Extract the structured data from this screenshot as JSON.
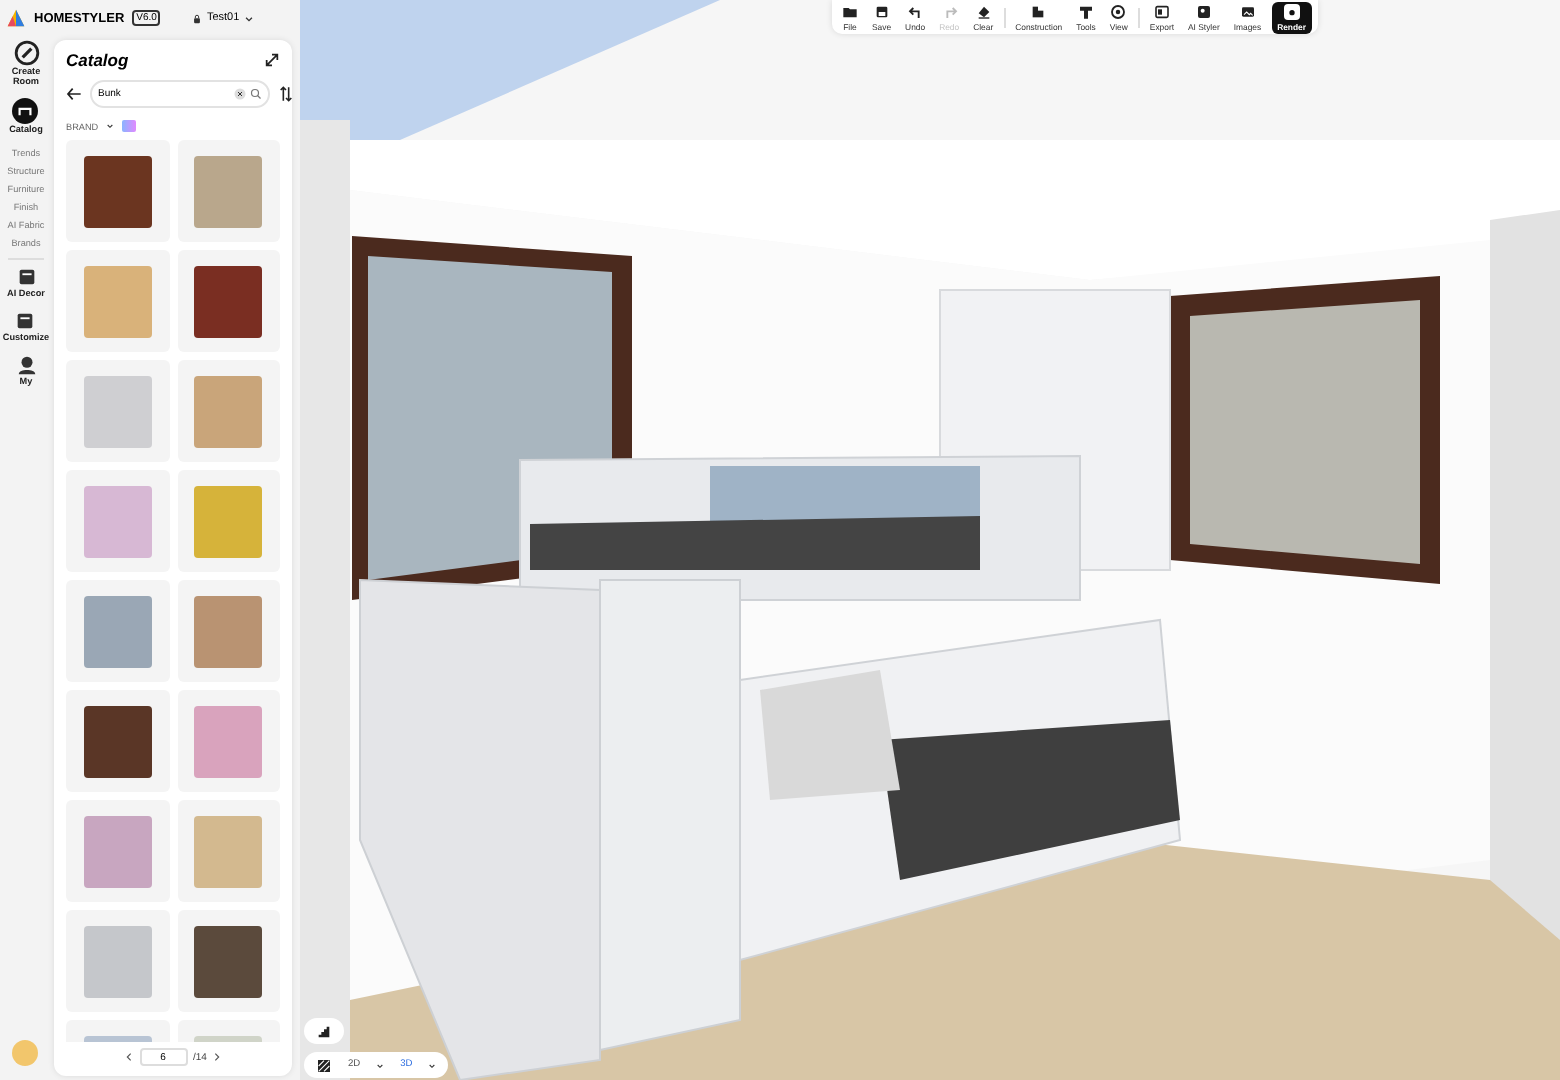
{
  "app": {
    "brand": "HOMESTYLER",
    "version": "V6.0",
    "project": "Test01"
  },
  "rail": {
    "items": [
      {
        "label": "Create Room",
        "selected": false
      },
      {
        "label": "Catalog",
        "selected": true
      }
    ],
    "sub_items": [
      "Trends",
      "Structure",
      "Furniture",
      "Finish",
      "AI Fabric",
      "Brands"
    ],
    "tools": [
      "AI Decor",
      "Customize",
      "My"
    ]
  },
  "catalog": {
    "title": "Catalog",
    "search": {
      "value": "Bunk"
    },
    "filter": "BRAND",
    "products": [
      {
        "color": "#6b3520"
      },
      {
        "color": "#b9a78c"
      },
      {
        "color": "#d9b27a"
      },
      {
        "color": "#7a2e22"
      },
      {
        "color": "#cfcfd2"
      },
      {
        "color": "#c9a57a"
      },
      {
        "color": "#d7b8d4"
      },
      {
        "color": "#d6b33a"
      },
      {
        "color": "#9aa7b5"
      },
      {
        "color": "#b99372"
      },
      {
        "color": "#5a3626"
      },
      {
        "color": "#d9a3bd"
      },
      {
        "color": "#c8a6c0"
      },
      {
        "color": "#d3b98f"
      },
      {
        "color": "#c5c7cb"
      },
      {
        "color": "#5b4a3c"
      },
      {
        "color": "#b8c4d4"
      },
      {
        "color": "#d0d4c8"
      }
    ],
    "pagination": {
      "page": "6",
      "total": "/14"
    }
  },
  "toolbar": [
    {
      "label": "File",
      "disabled": false
    },
    {
      "label": "Save",
      "disabled": false
    },
    {
      "label": "Undo",
      "disabled": false
    },
    {
      "label": "Redo",
      "disabled": true
    },
    {
      "label": "Clear",
      "disabled": false
    },
    {
      "label": "Construction",
      "disabled": false
    },
    {
      "label": "Tools",
      "disabled": false
    },
    {
      "label": "View",
      "disabled": false
    },
    {
      "label": "Export",
      "disabled": false
    },
    {
      "label": "AI Styler",
      "disabled": false
    },
    {
      "label": "Images",
      "disabled": false
    },
    {
      "label": "Render",
      "disabled": false,
      "kind": "render"
    }
  ],
  "view_modes": [
    {
      "label": "2D",
      "selected": false
    },
    {
      "label": "3D",
      "selected": true
    }
  ]
}
